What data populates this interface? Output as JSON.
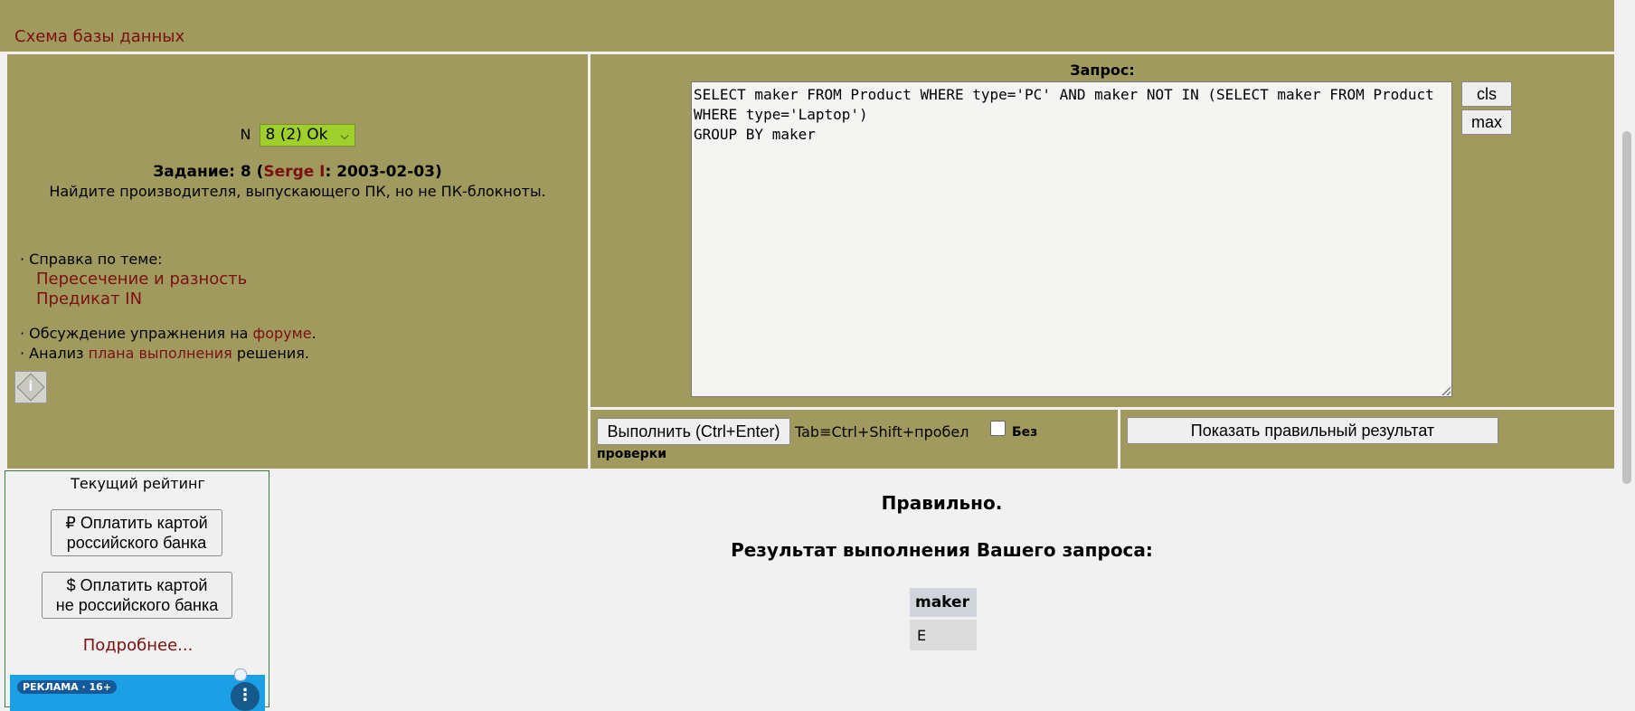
{
  "header": {
    "schema_link": "Схема базы данных"
  },
  "task": {
    "n_label": "N",
    "selector_value": "8 (2) Ok",
    "title_prefix": "Задание: 8 (",
    "author": "Serge I",
    "title_suffix": ": 2003-02-03)",
    "description": "Найдите производителя, выпускающего ПК, но не ПК-блокноты.",
    "help_label": "· Справка по теме:",
    "help_links": [
      "Пересечение и разность",
      "Предикат IN"
    ],
    "discussion_prefix": "· Обсуждение упражнения на ",
    "discussion_link": "форуме",
    "discussion_suffix": ".",
    "analysis_prefix": "· Анализ ",
    "analysis_link": "плана выполнения",
    "analysis_suffix": " решения.",
    "info_icon_text": "i"
  },
  "query": {
    "label": "Запрос:",
    "text": "SELECT maker FROM Product WHERE type='PC' AND maker NOT IN (SELECT maker FROM Product WHERE type='Laptop')\nGROUP BY maker",
    "cls_label": "cls",
    "max_label": "max"
  },
  "execute": {
    "button_label": "Выполнить (Ctrl+Enter)",
    "tab_hint": "Tab≡Ctrl+Shift+пробел",
    "no_check_label_1": "Без",
    "no_check_label_2": "проверки",
    "no_check_checked": false
  },
  "show_result": {
    "button_label": "Показать правильный результат"
  },
  "rating": {
    "title": "Текущий рейтинг",
    "pay_rub_line1": "₽ Оплатить картой",
    "pay_rub_line2": "российского банка",
    "pay_usd_line1": "$ Оплатить картой",
    "pay_usd_line2": "не российского банка",
    "more_link": "Подробнее...",
    "ad_badge": "РЕКЛАМА · 16+",
    "ad_menu": "⋮"
  },
  "result": {
    "status": "Правильно.",
    "title": "Результат выполнения Вашего запроса:",
    "columns": [
      "maker"
    ],
    "rows": [
      [
        "E"
      ]
    ]
  },
  "colors": {
    "panel_bg": "#a09a5e",
    "link": "#7a1010",
    "select_bg": "#9ecf2a",
    "ad_bg": "#1ba0e6"
  }
}
